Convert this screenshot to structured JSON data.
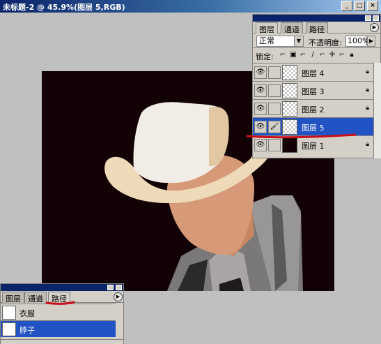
{
  "window": {
    "title": "未标题-2 @ 45.9%(图层 5,RGB)"
  },
  "colors": {
    "canvas": "#130205",
    "hat": "#eed9b8",
    "skin": "#d79a78",
    "selection": "#2253c4",
    "annotation": "#c8101a"
  },
  "layers_panel": {
    "tabs": [
      "图层",
      "通道",
      "路径"
    ],
    "blend_mode": "正常",
    "opacity_label": "不透明度:",
    "opacity_value": "100%",
    "lock_label": "锁定:",
    "layers": [
      {
        "name": "图层 4",
        "visible": true,
        "locked": true,
        "selected": false,
        "thumb": "transparent"
      },
      {
        "name": "图层 3",
        "visible": true,
        "locked": true,
        "selected": false,
        "thumb": "transparent"
      },
      {
        "name": "图层 2",
        "visible": true,
        "locked": true,
        "selected": false,
        "thumb": "transparent"
      },
      {
        "name": "图层 5",
        "visible": true,
        "locked": false,
        "selected": true,
        "thumb": "transparent"
      },
      {
        "name": "图层 1",
        "visible": true,
        "locked": true,
        "selected": false,
        "thumb": "dark"
      }
    ]
  },
  "paths_panel": {
    "tabs": [
      "图层",
      "通道",
      "路径"
    ],
    "paths": [
      {
        "name": "衣服",
        "selected": false
      },
      {
        "name": "脖子",
        "selected": true
      }
    ]
  },
  "icons": {
    "eye": "eye-icon",
    "brush": "brush-icon",
    "lock": "lock-icon",
    "panel_menu": "panel-menu-icon"
  }
}
